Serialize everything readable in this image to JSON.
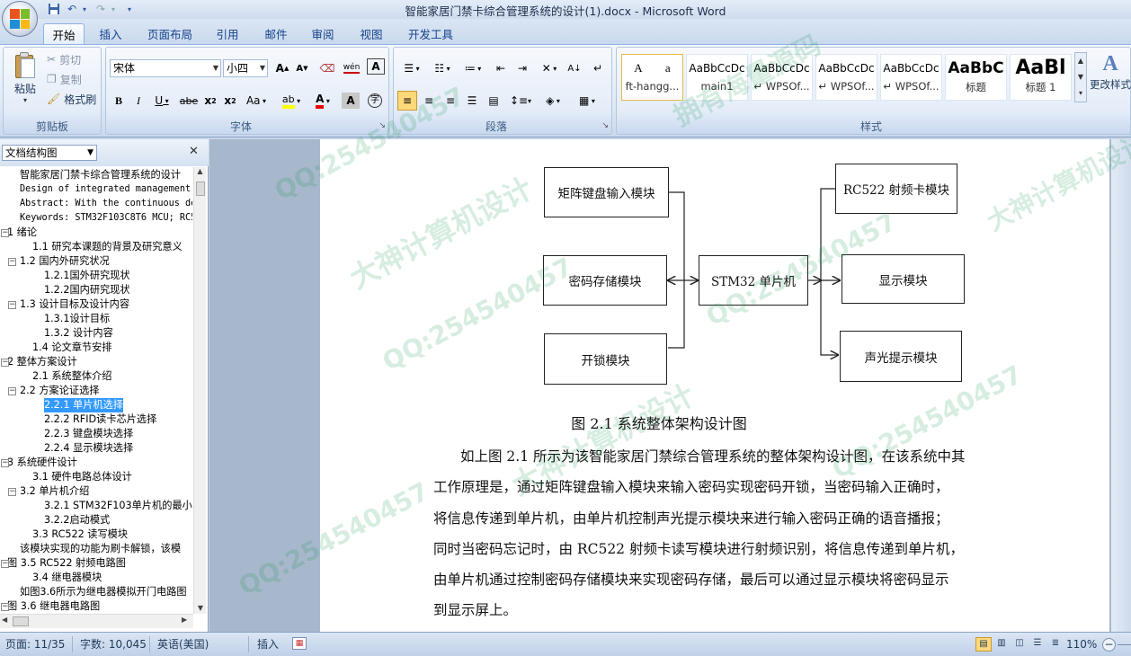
{
  "window": {
    "title": "智能家居门禁卡综合管理系统的设计(1).docx - Microsoft Word"
  },
  "quick_access": {
    "save_icon": "save-icon",
    "undo_icon": "undo-icon",
    "redo_icon": "redo-icon",
    "customize_icon": "dropdown-icon"
  },
  "tabs": [
    {
      "label": "开始",
      "active": true
    },
    {
      "label": "插入"
    },
    {
      "label": "页面布局"
    },
    {
      "label": "引用"
    },
    {
      "label": "邮件"
    },
    {
      "label": "审阅"
    },
    {
      "label": "视图"
    },
    {
      "label": "开发工具"
    }
  ],
  "clipboard": {
    "paste": "粘贴",
    "cut": "剪切",
    "copy": "复制",
    "format_painter": "格式刷",
    "group_label": "剪贴板"
  },
  "font": {
    "family": "宋体",
    "size": "小四",
    "group_label": "字体"
  },
  "paragraph": {
    "group_label": "段落"
  },
  "styles": {
    "group_label": "样式",
    "change_styles": "更改样式",
    "items": [
      {
        "preview": "A　　a",
        "name": "ft-hangg..."
      },
      {
        "preview": "AaBbCcDc",
        "name": "main1"
      },
      {
        "preview": "AaBbCcDc",
        "name": "↵ WPSOf..."
      },
      {
        "preview": "AaBbCcDc",
        "name": "↵ WPSOf..."
      },
      {
        "preview": "AaBbCcDc",
        "name": "↵ WPSOf..."
      },
      {
        "preview": "AaBbC",
        "name": "标题"
      },
      {
        "preview": "AaBl",
        "name": "标题 1"
      }
    ]
  },
  "nav": {
    "title": "文档结构图",
    "items": [
      {
        "text": "智能家居门禁卡综合管理系统的设计",
        "indent": 1
      },
      {
        "text": "Design of integrated management",
        "indent": 1,
        "mono": true
      },
      {
        "text": "Abstract: With the continuous de",
        "indent": 1,
        "mono": true
      },
      {
        "text": "Keywords: STM32F103C8T6 MCU; RC5",
        "indent": 1,
        "mono": true
      },
      {
        "text": "1 绪论",
        "indent": 0,
        "toggle": "⊟"
      },
      {
        "text": "1.1 研究本课题的背景及研究意义",
        "indent": 2
      },
      {
        "text": "1.2 国内外研究状况",
        "indent": 1,
        "toggle": "⊟"
      },
      {
        "text": "1.2.1国外研究现状",
        "indent": 3
      },
      {
        "text": "1.2.2国内研究现状",
        "indent": 3
      },
      {
        "text": "1.3 设计目标及设计内容",
        "indent": 1,
        "toggle": "⊟"
      },
      {
        "text": "1.3.1设计目标",
        "indent": 3
      },
      {
        "text": "1.3.2 设计内容",
        "indent": 3
      },
      {
        "text": "1.4 论文章节安排",
        "indent": 2
      },
      {
        "text": "2 整体方案设计",
        "indent": 0,
        "toggle": "⊟"
      },
      {
        "text": "2.1 系统整体介绍",
        "indent": 2
      },
      {
        "text": "2.2 方案论证选择",
        "indent": 1,
        "toggle": "⊟"
      },
      {
        "text": "2.2.1  单片机选择",
        "indent": 3,
        "selected": true
      },
      {
        "text": "2.2.2  RFID读卡芯片选择",
        "indent": 3
      },
      {
        "text": "2.2.3  键盘模块选择",
        "indent": 3
      },
      {
        "text": "2.2.4  显示模块选择",
        "indent": 3
      },
      {
        "text": "3 系统硬件设计",
        "indent": 0,
        "toggle": "⊟"
      },
      {
        "text": "3.1 硬件电路总体设计",
        "indent": 2
      },
      {
        "text": "3.2 单片机介绍",
        "indent": 1,
        "toggle": "⊟"
      },
      {
        "text": "3.2.1 STM32F103单片机的最小",
        "indent": 3
      },
      {
        "text": "3.2.2启动模式",
        "indent": 3
      },
      {
        "text": "3.3 RC522 读写模块",
        "indent": 2
      },
      {
        "text": "该模块实现的功能为刷卡解锁，该模",
        "indent": 1
      },
      {
        "text": "图 3.5  RC522 射频电路图",
        "indent": 0,
        "toggle": "⊟"
      },
      {
        "text": "3.4 继电器模块",
        "indent": 2
      },
      {
        "text": "如图3.6所示为继电器模拟开门电路图",
        "indent": 1
      },
      {
        "text": "图 3.6   继电器电路图",
        "indent": 0,
        "toggle": "⊟"
      }
    ]
  },
  "diagram": {
    "boxes": {
      "keypad": "矩阵键盘输入模块",
      "storage": "密码存储模块",
      "unlock": "开锁模块",
      "mcu": "STM32 单片机",
      "rc522": "RC522 射频卡模块",
      "display": "显示模块",
      "sound": "声光提示模块"
    },
    "caption": "图 2.1 系统整体架构设计图"
  },
  "body": {
    "lines": [
      "如上图 2.1 所示为该智能家居门禁综合管理系统的整体架构设计图，在该系统中其",
      "工作原理是，通过矩阵键盘输入模块来输入密码实现密码开锁，当密码输入正确时，",
      "将信息传递到单片机，由单片机控制声光提示模块来进行输入密码正确的语音播报；",
      "同时当密码忘记时，由 RC522 射频卡读写模块进行射频识别，将信息传递到单片机，",
      "由单片机通过控制密码存储模块来实现密码存储，最后可以通过显示模块将密码显示",
      "到显示屏上。"
    ]
  },
  "status": {
    "page": "页面: 11/35",
    "words": "字数: 10,045",
    "language": "英语(美国)",
    "insert": "插入",
    "zoom": "110%"
  },
  "watermarks": [
    "QQ:254540457",
    "大神计算机设计",
    "拥有海量源码"
  ]
}
